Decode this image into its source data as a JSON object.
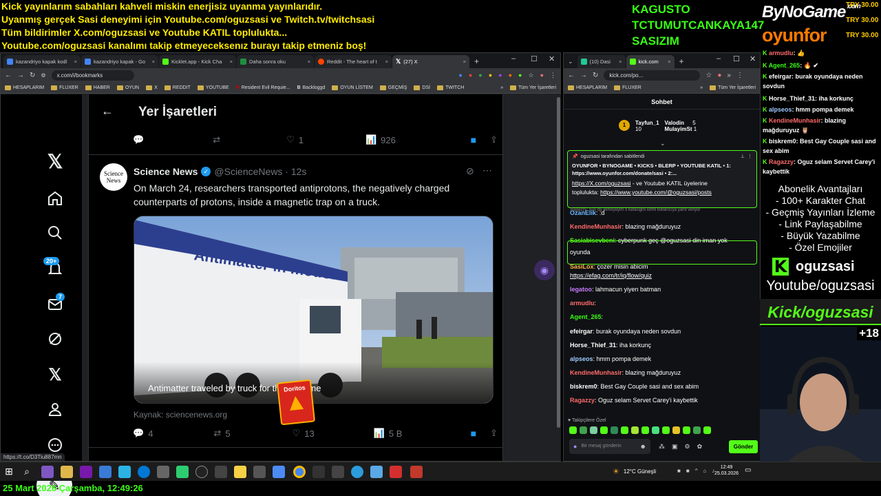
{
  "overlay": {
    "ticker": [
      "Kick yayınlarım sabahları kahveli miskin enerjisiz uyanma yayınlarıdır.",
      "Uyanmış gerçek Sasi deneyimi için Youtube.com/oguzsasi ve Twitch.tv/twitchsasi",
      "Tüm bildirimler X.com/oguzsasi ve Youtube KATIL toplulukta...",
      "Youtube.com/oguzsasi kanalımı takip etmeyeceksenız burayı takip etmeniz boş!"
    ],
    "subs": [
      "KAGUSTO",
      "TCTUMUTCANKAYA147",
      "SASIZIM"
    ],
    "brand1": "ByNoGame",
    "brand1_dot": ".com",
    "brand2": "oyunfor",
    "try": [
      "TRY 30.00",
      "TRY 30.00",
      "TRY 30.00"
    ],
    "chat": [
      {
        "name": "armudlu",
        "color": "#ff6b6b",
        "text": ": 👍"
      },
      {
        "name": "Agent_265",
        "color": "#39ff14",
        "text": ": 🔥 ✔"
      },
      {
        "name": "efeirgar",
        "color": "#ffffff",
        "text": ": burak oyundaya neden"
      },
      {
        "name": "",
        "color": "#ffffff",
        "text": "sovdun"
      },
      {
        "name": "Horse_Thief_31",
        "color": "#ffffff",
        "text": ": iha korkunç"
      },
      {
        "name": "alpseos",
        "color": "#9ecbff",
        "text": ": hmm pompa demek"
      },
      {
        "name": "KendineMunhasir",
        "color": "#ff6b6b",
        "text": ": blazing"
      },
      {
        "name": "",
        "color": "#ffffff",
        "text": "mağduruyuz 🦉"
      },
      {
        "name": "biskrem0",
        "color": "#ffffff",
        "text": ": Best Gay Couple sasi and"
      },
      {
        "name": "",
        "color": "#ffffff",
        "text": "sex abim"
      },
      {
        "name": "Ragazzy",
        "color": "#ff6b6b",
        "text": ": Oguz selam Servet Carey'i"
      },
      {
        "name": "",
        "color": "#ffffff",
        "text": "kaybettik"
      }
    ],
    "perks_title": "Abonelik Avantajları",
    "perks": [
      "- 100+ Karakter Chat",
      "- Geçmiş Yayınları İzleme",
      "- Link Paylaşabilme",
      "- Büyük Yazabilme",
      "- Özel Emojiler"
    ],
    "kick_user": "oguzsasi",
    "yt": "Youtube/oguzsasi",
    "kick_banner": "Kick/oguzsasi",
    "cam_badge": "+18",
    "datetime": "25 Mart 2026 Çarşamba, 12:49:26"
  },
  "left_browser": {
    "tabs": [
      {
        "label": "kazandriyo kapak kodl",
        "color": "#4285f4"
      },
      {
        "label": "kazandriyo kapak - Go",
        "color": "#4285f4"
      },
      {
        "label": "Kicklet.app - Kick Cha",
        "color": "#53fc18"
      },
      {
        "label": "Daha sonra oku",
        "color": "#1e8e3e"
      },
      {
        "label": "Reddit - The heart of t",
        "color": "#ff4500"
      },
      {
        "label": "(27) X",
        "color": "#ffffff"
      }
    ],
    "url": "x.com/i/bookmarks",
    "bookmarks": [
      "HESAPLARIM",
      "FLUXER",
      "HABER",
      "OYUN",
      "X",
      "REDDIT",
      "YOUTUBE",
      "Resident Evil Requie...",
      "Backloggd",
      "OYUN LİSTEM",
      "GEÇMİŞ",
      "DSİ",
      "TWITCH",
      "Tüm Yer İşaretleri"
    ],
    "status_url": "https://t.co/D3Tiu887mn"
  },
  "x": {
    "header_title": "Yer İşaretleri",
    "prev_likes": "1",
    "prev_views": "926",
    "badges": {
      "notifications": "20+",
      "messages": "7"
    },
    "post": {
      "author": "Science News",
      "handle": "@ScienceNews · 12s",
      "avatar_text": "Science News",
      "text": "On March 24, researchers transported antiprotons, the negatively charged counterparts of protons, inside a magnetic trap on a truck.",
      "truck_text": "Antimatter in motion",
      "caption": "Antimatter traveled by truck for the first time",
      "source": "Kaynak: sciencenews.org",
      "replies": "4",
      "reposts": "5",
      "likes": "13",
      "views": "5 B",
      "sticker": "Doritos"
    }
  },
  "right_browser": {
    "tabs": [
      {
        "label": "(10) Dasi",
        "color": "#20c997"
      },
      {
        "label": "kick.com",
        "color": "#53fc18"
      }
    ],
    "url": "kick.com/po...",
    "bookmarks": [
      "HESAPLARIM",
      "FLUXER",
      "Tüm Yer İşaretleri"
    ],
    "chat_title": "Sohbet",
    "leaders": [
      {
        "name": "Tayfun_1",
        "n": "10"
      },
      {
        "name": "Valodin",
        "n": "5"
      },
      {
        "name": "MulayimSt",
        "n": "1"
      }
    ],
    "pinned_by": "oguzsasi tarafından sabitlendi",
    "pinned_text": "OYUNFOR • BYNOGAME • KICKS • BLERP • YOUTUBE KATIL • 1: https://www.oyunfor.com/donate/sasi • 2:...",
    "msg_link1": "https://X.com/oguzsasi",
    "msg_text1": " - ve Youtube KATIL üyelerine",
    "msg_text2": "toplulukta: ",
    "msg_link2": "https://www.youtube.com/@oguzsasi/posts",
    "system": "Ragazzy: Sus da akmeyeyim o kafacigini isimli kullanıcıya yanıt veriyor",
    "messages": [
      {
        "name": "OzanElik",
        "color": "#6bb8ff",
        "text": ": :d"
      },
      {
        "name": "KendineMunhasir",
        "color": "#ff6b6b",
        "text": ": blazing mağduruyuz"
      },
      {
        "name": "Sasiabisevbeni",
        "color": "#53fc18",
        "text": ": cyberpunk geç @oguzsasi din iman yok"
      },
      {
        "name": "",
        "color": "#ffffff",
        "text": "oyunda"
      },
      {
        "name": "SasiLox",
        "color": "#ffb347",
        "text": ": çozer misin abicim"
      },
      {
        "name": "",
        "color": "#ffffff",
        "text": "https://efag.com/tr/iq/flow/quiz"
      },
      {
        "name": "legatoo",
        "color": "#c77dff",
        "text": ": lahmacun yiyen batman"
      },
      {
        "name": "armudlu",
        "color": "#ff6b6b",
        "text": ":"
      },
      {
        "name": "Agent_265",
        "color": "#39ff14",
        "text": ":"
      },
      {
        "name": "efeirgar",
        "color": "#ffffff",
        "text": ": burak oyundaya neden sovdun"
      },
      {
        "name": "Horse_Thief_31",
        "color": "#ffffff",
        "text": ": iha korkunç"
      },
      {
        "name": "alpseos",
        "color": "#9ecbff",
        "text": ": hmm pompa demek"
      },
      {
        "name": "KendineMunhasir",
        "color": "#ff6b6b",
        "text": ": blazing mağduruyuz"
      },
      {
        "name": "biskrem0",
        "color": "#ffffff",
        "text": ": Best Gay Couple sasi and sex abim"
      },
      {
        "name": "Ragazzy",
        "color": "#ff6b6b",
        "text": ": Oguz selam Servet Carey'i kaybettik"
      }
    ],
    "emote_label": "Takipçilere Özel",
    "input_placeholder": "Bir mesaj gönderin",
    "send": "Gönder"
  },
  "taskbar": {
    "weather": "12°C  Güneşli",
    "time": "12:49",
    "date": "25.03.2026"
  }
}
